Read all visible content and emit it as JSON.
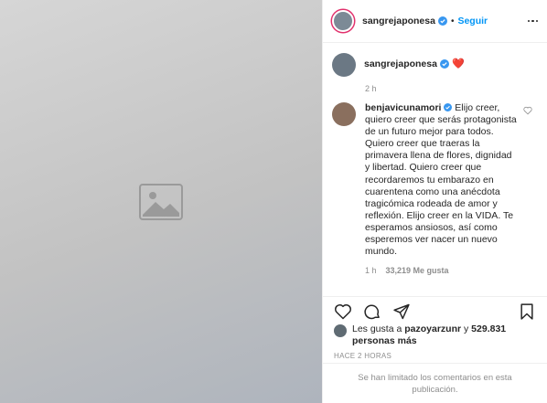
{
  "post": {
    "author": "sangrejaponesa",
    "follow_label": "Seguir",
    "separator": "•"
  },
  "caption": {
    "username": "sangrejaponesa",
    "emoji": "❤️",
    "time": "2 h"
  },
  "comment": {
    "username": "benjavicunamori",
    "text": "Elijo creer, quiero creer que serás protagonista de un futuro mejor para todos. Quiero creer que traeras la primavera llena de flores, dignidad y libertad. Quiero creer que recordaremos tu embarazo en cuarentena como una anécdota tragicómica rodeada de amor y reflexión. Elijo creer en la VIDA. Te esperamos ansiosos, así como esperemos ver nacer un nuevo mundo.",
    "time": "1 h",
    "likes": "33,219 Me gusta"
  },
  "likes": {
    "prefix": "Les gusta a",
    "user": "pazoyarzunr",
    "conj": "y",
    "count": "529.831 personas más"
  },
  "timestamp": "HACE 2 HORAS",
  "comments_limited": "Se han limitado los comentarios en esta publicación.",
  "colors": {
    "link": "#0095f6",
    "text": "#262626",
    "muted": "#8e8e8e",
    "heart": "#ed4956"
  },
  "icons": [
    "verified-badge-icon",
    "more-options-icon",
    "heart-icon",
    "comment-icon",
    "share-icon",
    "bookmark-icon"
  ]
}
